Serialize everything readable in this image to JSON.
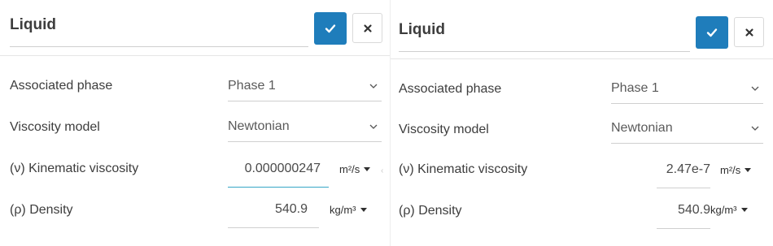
{
  "left_panel": {
    "title": "Liquid",
    "fields": {
      "associated_phase": {
        "label": "Associated phase",
        "value": "Phase 1"
      },
      "viscosity_model": {
        "label": "Viscosity model",
        "value": "Newtonian"
      },
      "kinematic_viscosity": {
        "label": "(ν) Kinematic viscosity",
        "value": "0.000000247",
        "unit": "m²/s"
      },
      "density": {
        "label": "(ρ) Density",
        "value": "540.9",
        "unit": "kg/m³"
      }
    },
    "overflow_arrow": "‹"
  },
  "right_panel": {
    "title": "Liquid",
    "fields": {
      "associated_phase": {
        "label": "Associated phase",
        "value": "Phase 1"
      },
      "viscosity_model": {
        "label": "Viscosity model",
        "value": "Newtonian"
      },
      "kinematic_viscosity": {
        "label": "(ν) Kinematic viscosity",
        "value": "2.47e-7",
        "unit": "m²/s"
      },
      "density": {
        "label": "(ρ) Density",
        "value": "540.9",
        "unit": "kg/m³"
      }
    }
  },
  "icons": {
    "confirm": "check-icon",
    "close": "close-icon",
    "dropdown": "chevron-down-icon",
    "unit_dropdown": "caret-down-icon"
  },
  "colors": {
    "accent": "#1f7dbb",
    "focus_underline": "#36a7c7"
  }
}
